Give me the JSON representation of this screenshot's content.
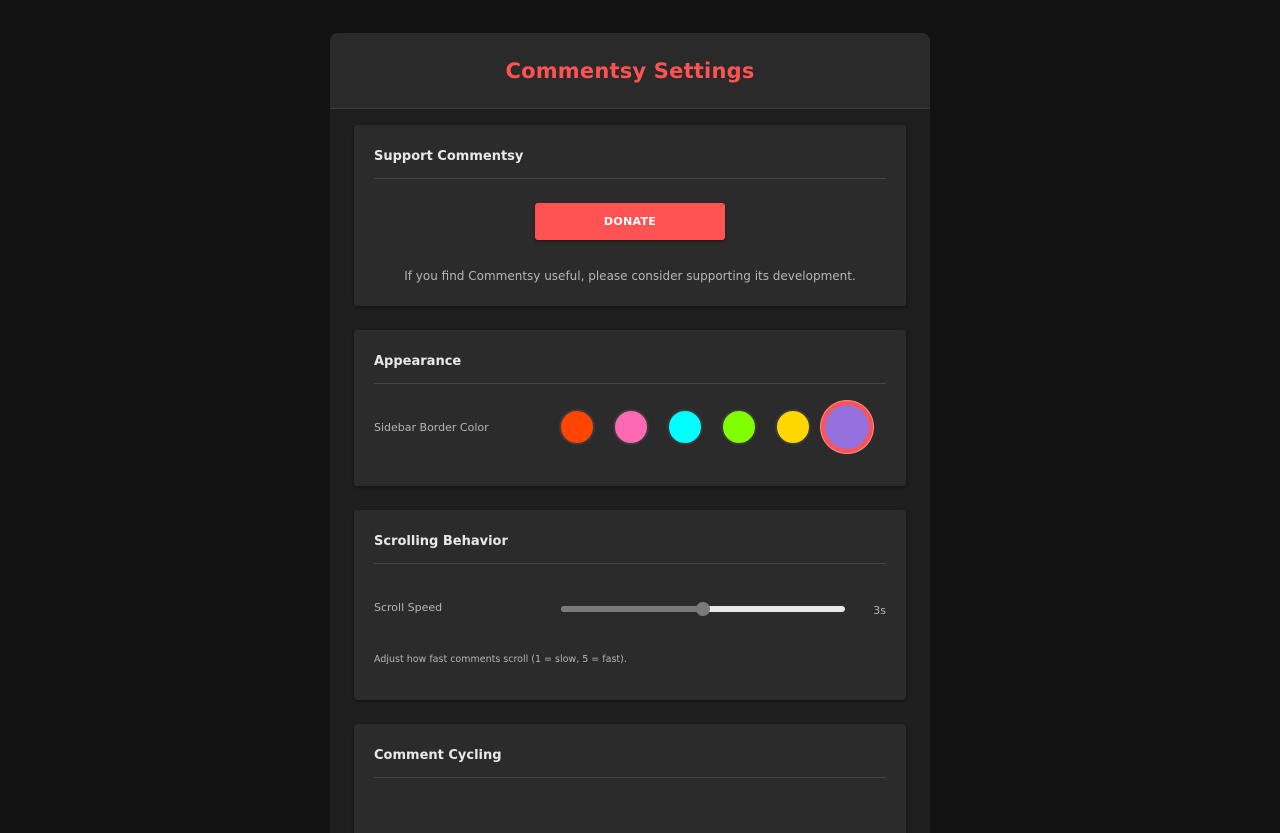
{
  "title": "Commentsy Settings",
  "colors": {
    "accent": "#ff5252",
    "background": "#121212",
    "panel": "#1e1e1e",
    "section": "#2b2b2b"
  },
  "support": {
    "heading": "Support Commentsy",
    "donate_label": "DONATE",
    "note": "If you find Commentsy useful, please consider supporting its development."
  },
  "appearance": {
    "heading": "Appearance",
    "border_color_label": "Sidebar Border Color",
    "swatches": [
      {
        "name": "orange-red",
        "color": "#ff4500",
        "selected": false
      },
      {
        "name": "pink",
        "color": "#ff69b4",
        "selected": false
      },
      {
        "name": "cyan",
        "color": "#00ffff",
        "selected": false
      },
      {
        "name": "lime",
        "color": "#7fff00",
        "selected": false
      },
      {
        "name": "gold",
        "color": "#ffd700",
        "selected": false
      },
      {
        "name": "purple",
        "color": "#9370db",
        "selected": true
      }
    ]
  },
  "scrolling": {
    "heading": "Scrolling Behavior",
    "speed_label": "Scroll Speed",
    "speed_min": 1,
    "speed_max": 5,
    "speed_value": 3,
    "speed_display": "3s",
    "help": "Adjust how fast comments scroll (1 = slow, 5 = fast)."
  },
  "cycling": {
    "heading": "Comment Cycling"
  }
}
